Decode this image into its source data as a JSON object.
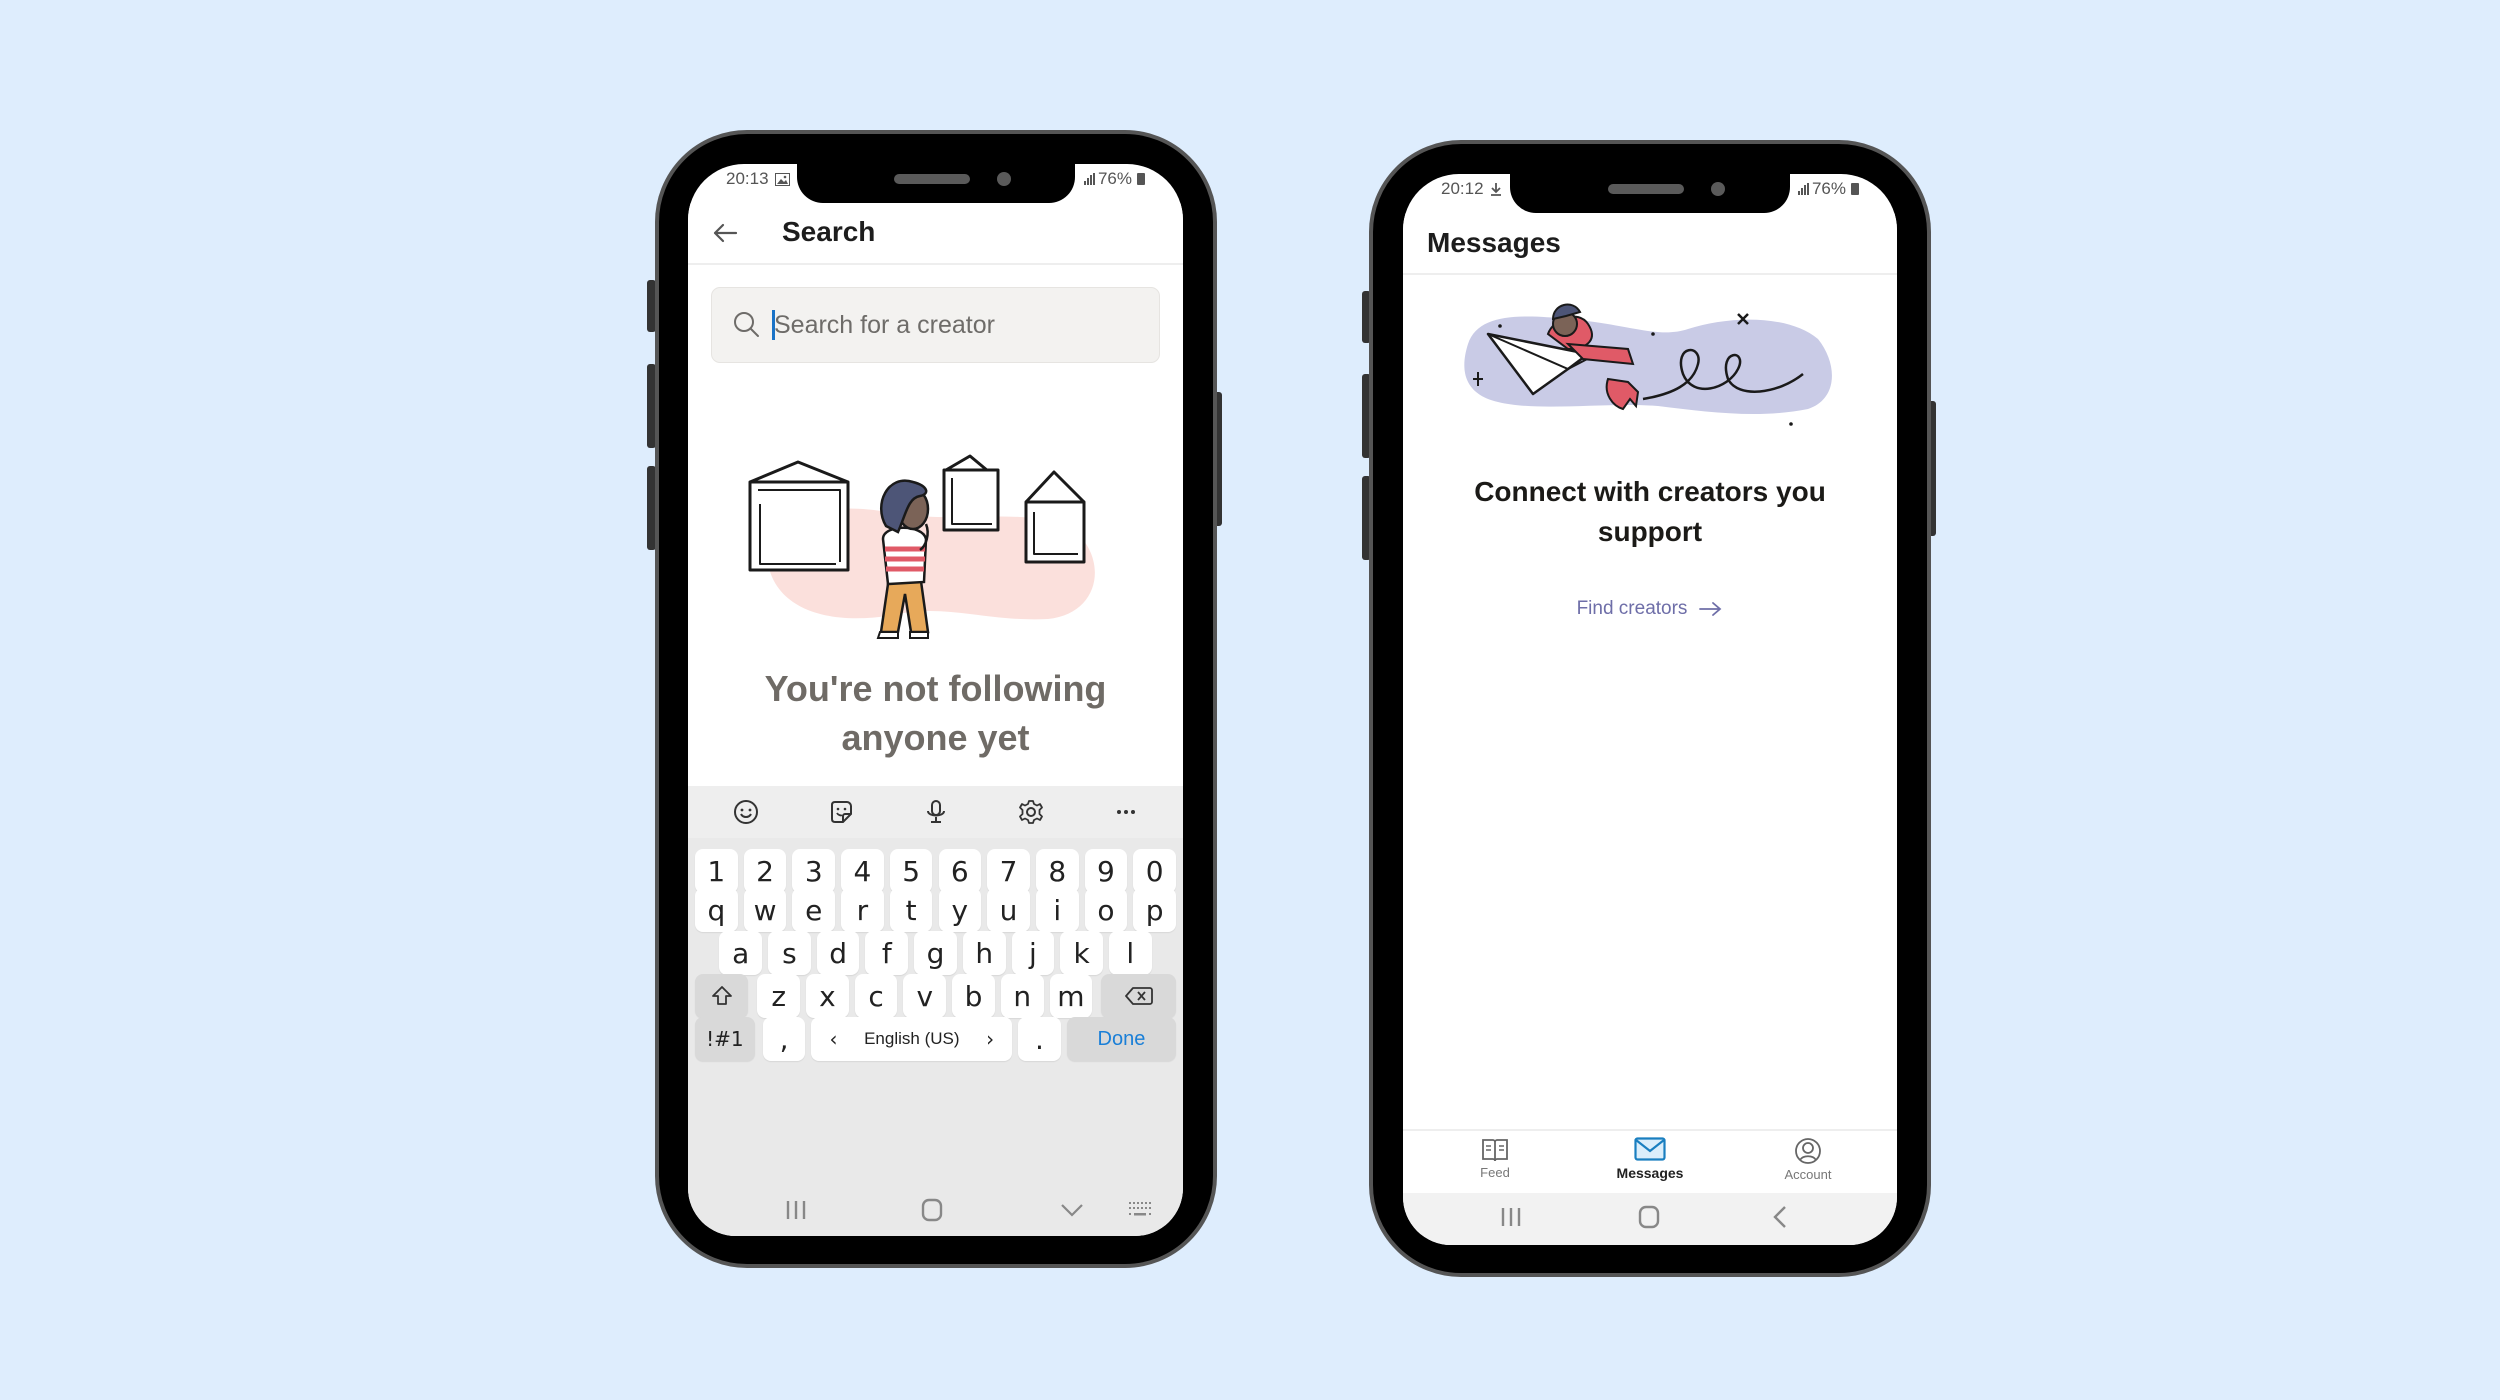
{
  "colors": {
    "background": "#deedfd",
    "accent_blue": "#1a7fd7",
    "link_purple": "#6e6ea8",
    "illustration_pink": "#fbe0dc",
    "illustration_lavender": "#c9cbe6",
    "illustration_red": "#e05a67"
  },
  "left_phone": {
    "status": {
      "time": "20:13",
      "notification_icon": "image-icon",
      "battery": "76%"
    },
    "header": {
      "back_icon": "arrow-left-icon",
      "title": "Search"
    },
    "search": {
      "placeholder": "Search for a creator",
      "value": ""
    },
    "empty_state": {
      "title_line1": "You're not following",
      "title_line2": "anyone yet",
      "illustration": "person-looking-at-frames"
    },
    "keyboard": {
      "toolbar": [
        "emoji-icon",
        "sticker-icon",
        "microphone-icon",
        "settings-icon",
        "more-icon"
      ],
      "row_numbers": [
        "1",
        "2",
        "3",
        "4",
        "5",
        "6",
        "7",
        "8",
        "9",
        "0"
      ],
      "row1": [
        "q",
        "w",
        "e",
        "r",
        "t",
        "y",
        "u",
        "i",
        "o",
        "p"
      ],
      "row2": [
        "a",
        "s",
        "d",
        "f",
        "g",
        "h",
        "j",
        "k",
        "l"
      ],
      "row3": [
        "z",
        "x",
        "c",
        "v",
        "b",
        "n",
        "m"
      ],
      "symbols_key": "!#1",
      "comma_key": ",",
      "space_label": "English (US)",
      "space_prev": "‹",
      "space_next": "›",
      "period_key": ".",
      "done_key": "Done"
    },
    "system_nav": [
      "recents-icon",
      "home-icon",
      "hide-keyboard-icon",
      "keyboard-switch-icon"
    ]
  },
  "right_phone": {
    "status": {
      "time": "20:12",
      "notification_icon": "download-icon",
      "battery": "76%"
    },
    "header": {
      "title": "Messages"
    },
    "empty_state": {
      "title_line1": "Connect with creators you",
      "title_line2": "support",
      "illustration": "person-on-paper-plane"
    },
    "find_link": {
      "label": "Find creators",
      "icon": "arrow-right-icon"
    },
    "tabs": [
      {
        "label": "Feed",
        "icon": "book-icon",
        "active": false
      },
      {
        "label": "Messages",
        "icon": "mail-icon",
        "active": true
      },
      {
        "label": "Account",
        "icon": "user-circle-icon",
        "active": false
      }
    ],
    "system_nav": [
      "recents-icon",
      "home-icon",
      "back-icon"
    ]
  }
}
